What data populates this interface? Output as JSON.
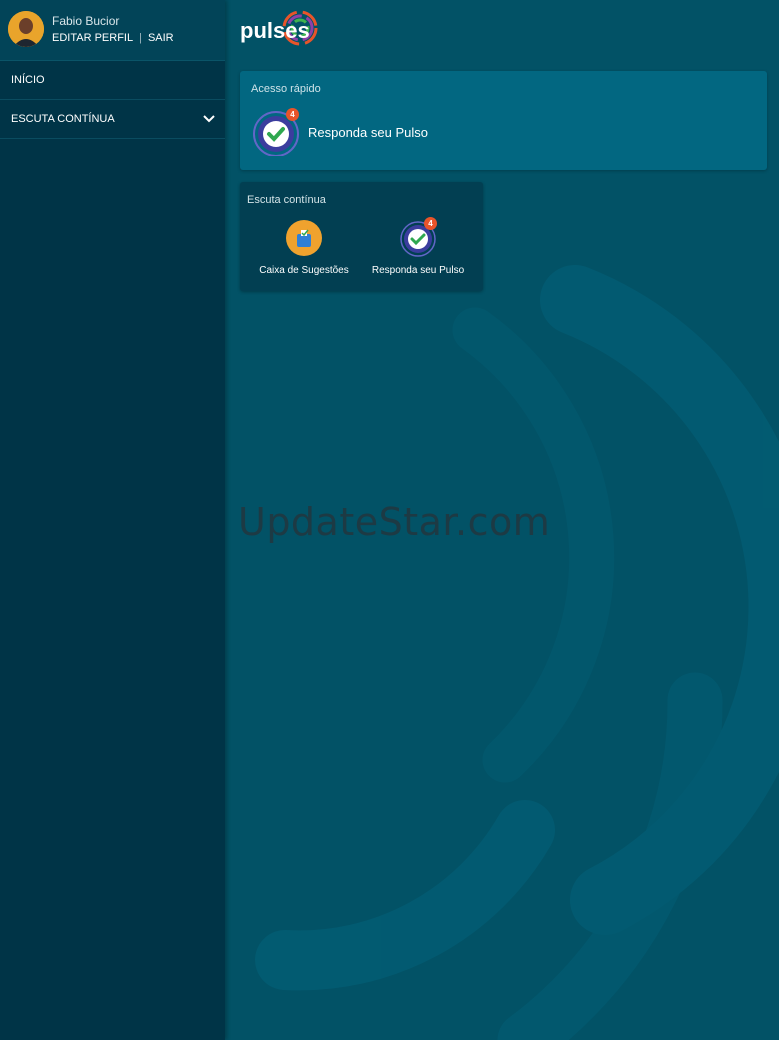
{
  "profile": {
    "name": "Fabio Bucior",
    "edit_label": "EDITAR PERFIL",
    "separator": "|",
    "logout_label": "SAIR",
    "avatar_icon": "user-avatar-photo"
  },
  "sidebar": {
    "items": [
      {
        "label": "INÍCIO"
      },
      {
        "label": "ESCUTA CONTÍNUA",
        "chevron": "❯"
      }
    ]
  },
  "logo": {
    "text": "pulses"
  },
  "quick_access": {
    "title": "Acesso rápido",
    "item": {
      "label": "Responda seu Pulso",
      "badge": "4",
      "icon": "pulse-check-icon"
    }
  },
  "escuta": {
    "title": "Escuta contínua",
    "items": [
      {
        "label": "Caixa de Sugestões",
        "icon": "suggestion-box-icon"
      },
      {
        "label": "Responda seu Pulso",
        "badge": "4",
        "icon": "pulse-check-icon"
      }
    ]
  },
  "watermark": "UpdateStar.com",
  "colors": {
    "sidebar": "#003447",
    "main_bg": "#025266",
    "quick_card": "#026781",
    "escuta_card": "#023f52",
    "badge": "#e8542a",
    "check_green": "#2fa84f",
    "pulse_purple": "#3b3d9e"
  }
}
